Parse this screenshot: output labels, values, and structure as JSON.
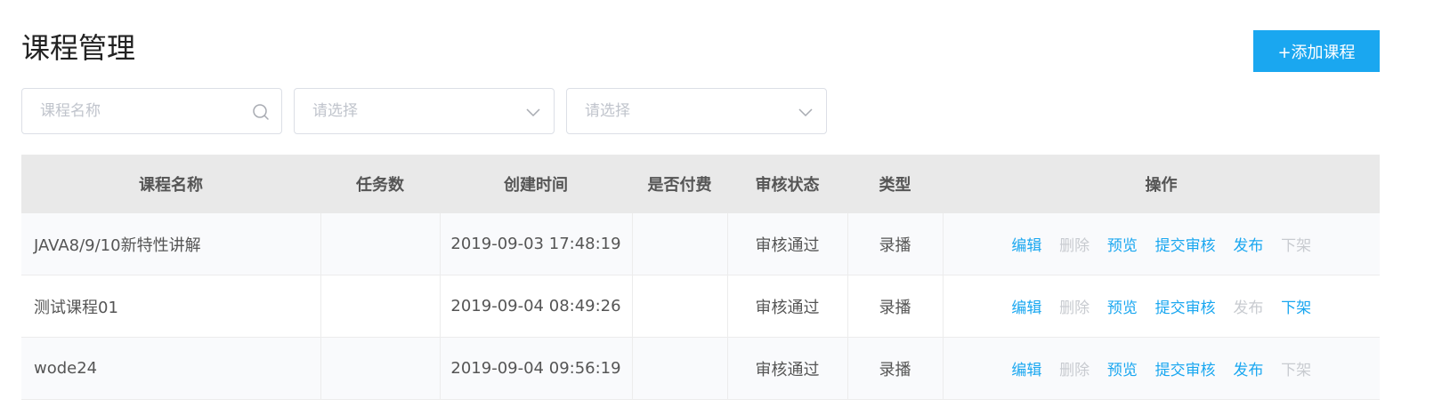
{
  "header": {
    "title": "课程管理",
    "add_button": "+添加课程"
  },
  "filters": {
    "name_placeholder": "课程名称",
    "select1_placeholder": "请选择",
    "select2_placeholder": "请选择"
  },
  "table": {
    "columns": [
      "课程名称",
      "任务数",
      "创建时间",
      "是否付费",
      "审核状态",
      "类型",
      "操作"
    ],
    "rows": [
      {
        "name": "JAVA8/9/10新特性讲解",
        "tasks": "",
        "created": "2019-09-03 17:48:19",
        "paid": "",
        "status": "审核通过",
        "type": "录播",
        "actions": [
          {
            "label": "编辑",
            "enabled": true
          },
          {
            "label": "删除",
            "enabled": false
          },
          {
            "label": "预览",
            "enabled": true
          },
          {
            "label": "提交审核",
            "enabled": true
          },
          {
            "label": "发布",
            "enabled": true
          },
          {
            "label": "下架",
            "enabled": false
          }
        ]
      },
      {
        "name": "测试课程01",
        "tasks": "",
        "created": "2019-09-04 08:49:26",
        "paid": "",
        "status": "审核通过",
        "type": "录播",
        "actions": [
          {
            "label": "编辑",
            "enabled": true
          },
          {
            "label": "删除",
            "enabled": false
          },
          {
            "label": "预览",
            "enabled": true
          },
          {
            "label": "提交审核",
            "enabled": true
          },
          {
            "label": "发布",
            "enabled": false
          },
          {
            "label": "下架",
            "enabled": true
          }
        ]
      },
      {
        "name": "wode24",
        "tasks": "",
        "created": "2019-09-04 09:56:19",
        "paid": "",
        "status": "审核通过",
        "type": "录播",
        "actions": [
          {
            "label": "编辑",
            "enabled": true
          },
          {
            "label": "删除",
            "enabled": false
          },
          {
            "label": "预览",
            "enabled": true
          },
          {
            "label": "提交审核",
            "enabled": true
          },
          {
            "label": "发布",
            "enabled": true
          },
          {
            "label": "下架",
            "enabled": false
          }
        ]
      }
    ]
  },
  "colors": {
    "accent": "#1aa7f0",
    "disabled": "#c8cbd0",
    "header_bg": "#e9e9e9"
  },
  "icons": {
    "search": "search-icon",
    "dropdown": "chevron-down-icon"
  }
}
